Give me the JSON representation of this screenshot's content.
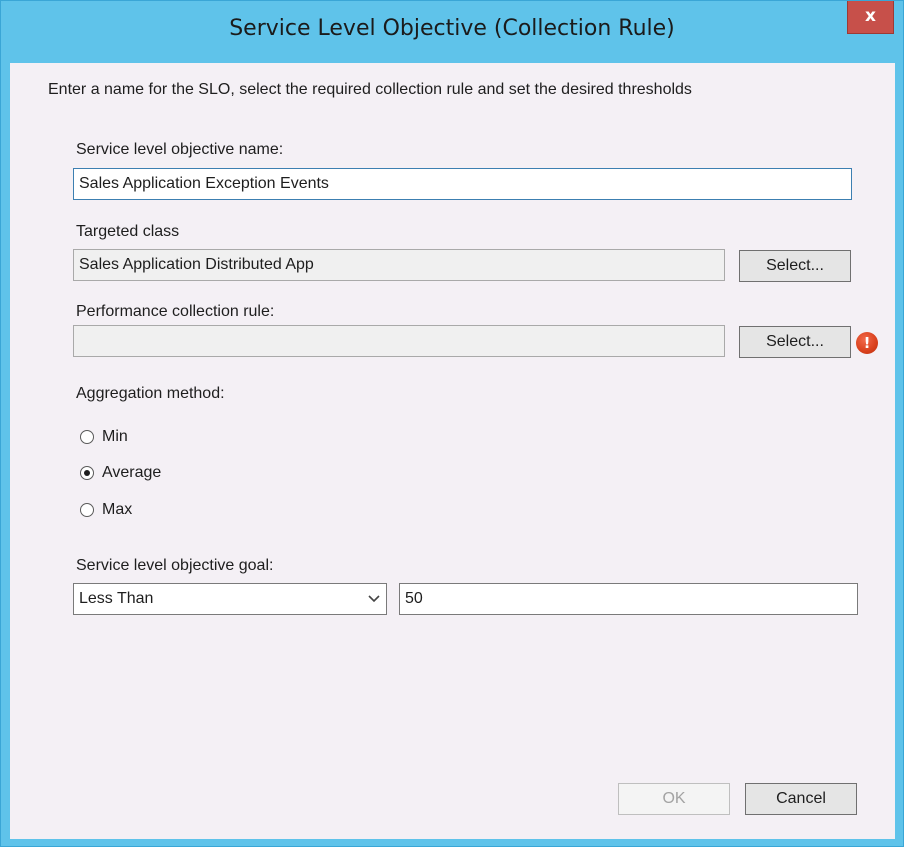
{
  "window": {
    "title": "Service Level Objective (Collection Rule)",
    "close_glyph": "x"
  },
  "instructions": "Enter a name for the SLO, select the required collection rule and set the desired thresholds",
  "slo_name": {
    "label": "Service level objective name:",
    "value": "Sales Application Exception Events"
  },
  "targeted_class": {
    "label": "Targeted class",
    "value": "Sales Application Distributed App",
    "button_label": "Select..."
  },
  "collection_rule": {
    "label": "Performance collection rule:",
    "value": "",
    "button_label": "Select...",
    "error_icon": "error-exclamation-icon",
    "error_glyph": "!"
  },
  "aggregation": {
    "label": "Aggregation method:",
    "options": [
      {
        "label": "Min",
        "selected": false
      },
      {
        "label": "Average",
        "selected": true
      },
      {
        "label": "Max",
        "selected": false
      }
    ]
  },
  "goal": {
    "label": "Service level objective goal:",
    "operator": "Less Than",
    "value": "50"
  },
  "footer": {
    "ok_label": "OK",
    "ok_enabled": false,
    "cancel_label": "Cancel"
  },
  "colors": {
    "title_bar": "#5fc3ea",
    "close_button": "#c7504a",
    "dialog_background": "#f4f0f5",
    "error_icon": "#d9401c"
  }
}
